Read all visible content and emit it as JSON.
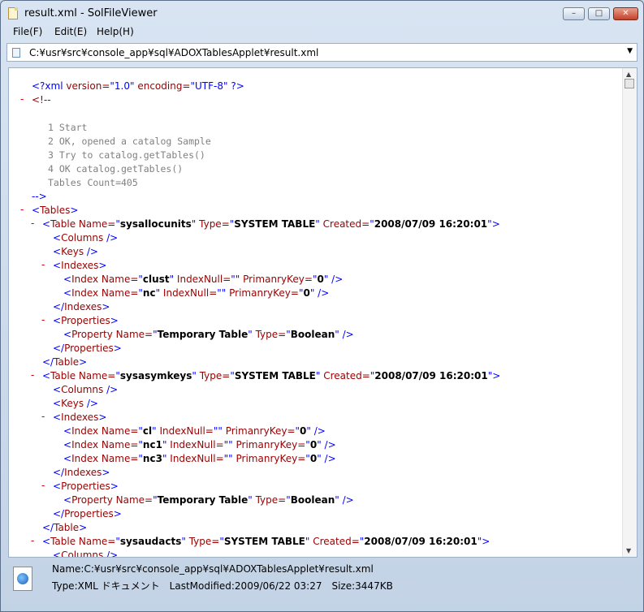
{
  "window": {
    "title": "result.xml - SolFileViewer",
    "min_glyph": "–",
    "max_glyph": "□",
    "close_glyph": "✕"
  },
  "menu": [
    "File(F)",
    "Edit(E)",
    "Help(H)"
  ],
  "address": {
    "path": "C:¥usr¥src¥console_app¥sql¥ADOXTablesApplet¥result.xml",
    "dropdown_glyph": "▼"
  },
  "xml": {
    "decl_open": "<?xml ",
    "decl_attr1": "version=",
    "decl_val1": "\"1.0\"",
    "decl_attr2": " encoding=",
    "decl_val2": "\"UTF-8\"",
    "decl_close": " ?>",
    "comment_open": "<!--",
    "comment_lines": [
      "1 Start",
      "2 OK, opened a catalog Sample",
      "3 Try to catalog.getTables()",
      "4 OK catalog.getTables()",
      "Tables Count=405"
    ],
    "comment_close": "-->",
    "toggle": "-",
    "tables_open": "<Tables>",
    "tables": [
      {
        "name": "sysallocunits",
        "type": "SYSTEM TABLE",
        "created": "2008/07/09 16:20:01",
        "indexes": [
          {
            "name": "clust",
            "null": "",
            "pk": "0"
          },
          {
            "name": "nc",
            "null": "",
            "pk": "0"
          }
        ],
        "property": {
          "name": "Temporary Table",
          "type": "Boolean"
        }
      },
      {
        "name": "sysasymkeys",
        "type": "SYSTEM TABLE",
        "created": "2008/07/09 16:20:01",
        "indexes": [
          {
            "name": "cl",
            "null": "",
            "pk": "0"
          },
          {
            "name": "nc1",
            "null": "",
            "pk": "0"
          },
          {
            "name": "nc3",
            "null": "",
            "pk": "0"
          }
        ],
        "property": {
          "name": "Temporary Table",
          "type": "Boolean"
        }
      },
      {
        "name": "sysaudacts",
        "type": "SYSTEM TABLE",
        "created": "2008/07/09 16:20:01",
        "indexes": [],
        "property": null
      }
    ]
  },
  "status": {
    "name_line": "Name:C:¥usr¥src¥console_app¥sql¥ADOXTablesApplet¥result.xml",
    "info_line": "Type:XML ドキュメント　LastModified:2009/06/22 03:27　Size:3447KB"
  }
}
